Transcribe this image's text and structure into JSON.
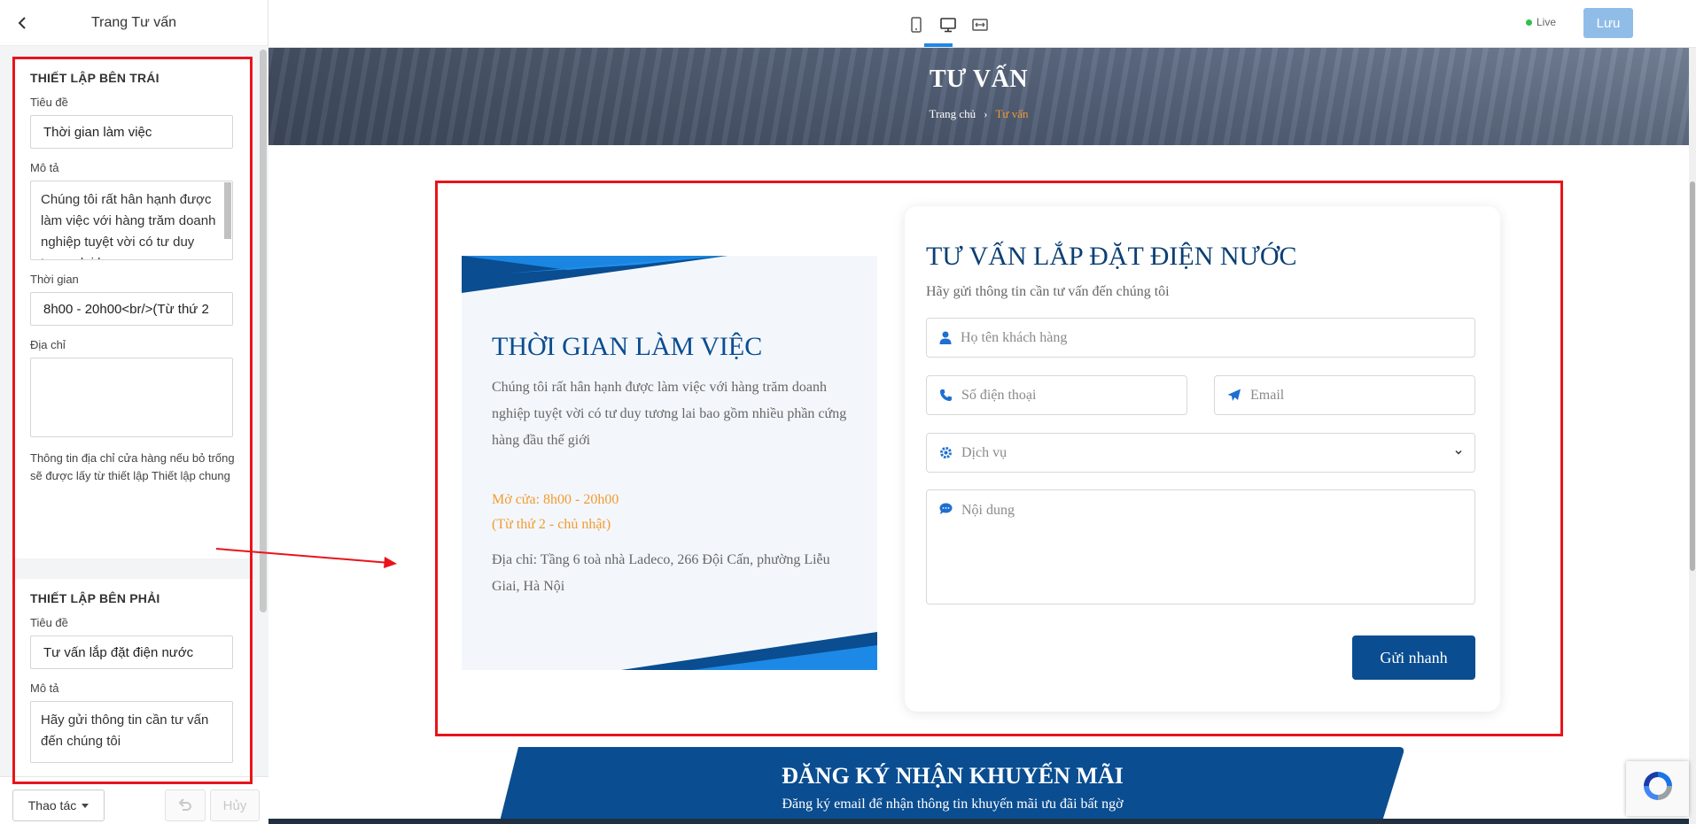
{
  "sidebar": {
    "title": "Trang Tư vấn",
    "left_section": {
      "heading": "THIẾT LẬP BÊN TRÁI",
      "title_label": "Tiêu đề",
      "title_value": "Thời gian làm việc",
      "desc_label": "Mô tả",
      "desc_value": "Chúng tôi rất hân hạnh được làm việc với hàng trăm doanh nghiệp tuyệt vời có tư duy tương lai bao",
      "time_label": "Thời gian",
      "time_value": "8h00 - 20h00<br/>(Từ thứ 2",
      "address_label": "Địa chỉ",
      "address_value": "",
      "address_note": "Thông tin địa chỉ cửa hàng nếu bỏ trống sẽ được lấy từ thiết lập Thiết lập chung"
    },
    "right_section": {
      "heading": "THIẾT LẬP BÊN PHẢI",
      "title_label": "Tiêu đề",
      "title_value": "Tư vấn lắp đặt điện nước",
      "desc_label": "Mô tả",
      "desc_value": "Hãy gửi thông tin cần tư vấn đến chúng tôi"
    },
    "footer": {
      "actions_label": "Thao tác",
      "undo_icon": "undo-icon",
      "redo_label": "Hủy"
    }
  },
  "topbar": {
    "live_label": "Live",
    "save_label": "Lưu",
    "devices": [
      "mobile-icon",
      "desktop-icon",
      "fullwidth-icon"
    ],
    "colors": {
      "accent": "#1e88e5",
      "live": "#2ec04a",
      "save_bg": "#90bde8"
    }
  },
  "preview": {
    "hero": {
      "title": "TƯ VẤN",
      "crumb_home": "Trang chủ",
      "crumb_sep": "›",
      "crumb_current": "Tư vấn"
    },
    "left_card": {
      "title": "THỜI GIAN LÀM VIỆC",
      "desc": "Chúng tôi rất hân hạnh được làm việc với hàng trăm doanh nghiệp tuyệt vời có tư duy tương lai bao gồm nhiều phần cứng hàng đầu thế giới",
      "open_line1": "Mở cửa: 8h00 - 20h00",
      "open_line2": "(Từ thứ 2 - chủ nhật)",
      "address": "Địa chỉ: Tầng 6 toà nhà Ladeco, 266 Đội Cấn, phường Liễu Giai, Hà Nội"
    },
    "form": {
      "title": "TƯ VẤN LẮP ĐẶT ĐIỆN NƯỚC",
      "subtitle": "Hãy gửi thông tin cần tư vấn đến chúng tôi",
      "name_placeholder": "Họ tên khách hàng",
      "phone_placeholder": "Số điện thoại",
      "email_placeholder": "Email",
      "service_placeholder": "Dịch vụ",
      "message_placeholder": "Nội dung",
      "submit_label": "Gửi nhanh"
    },
    "promo": {
      "title": "ĐĂNG KÝ NHẬN KHUYẾN MÃI",
      "subtitle": "Đăng ký email để nhận thông tin khuyến mãi ưu đãi bất ngờ"
    },
    "colors": {
      "brand": "#0a4d91",
      "orange": "#f39a2f",
      "outline": "#e8141b"
    }
  }
}
